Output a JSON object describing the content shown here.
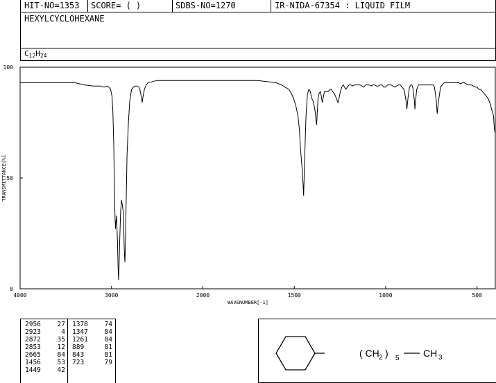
{
  "header": {
    "hit_no": "HIT-NO=1353",
    "score": "SCORE=  (  )",
    "sdbs_no": "SDBS-NO=1270",
    "ir_id": "IR-NIDA-67354 : LIQUID FILM"
  },
  "compound": {
    "name": "HEXYLCYCLOHEXANE",
    "formula_parts": [
      {
        "text": "C",
        "sub": false
      },
      {
        "text": "12",
        "sub": true
      },
      {
        "text": "H",
        "sub": false
      },
      {
        "text": "24",
        "sub": true
      }
    ]
  },
  "structure": {
    "chain_open": "( CH",
    "chain_sub": "2",
    "chain_close": ")",
    "chain_repeat": "5",
    "terminal": "CH",
    "terminal_sub": "3"
  },
  "peak_table": {
    "left": [
      [
        "2956",
        "27"
      ],
      [
        "2923",
        "4"
      ],
      [
        "2872",
        "35"
      ],
      [
        "2853",
        "12"
      ],
      [
        "2665",
        "84"
      ],
      [
        "1456",
        "53"
      ],
      [
        "1449",
        "42"
      ]
    ],
    "right": [
      [
        "1378",
        "74"
      ],
      [
        "1347",
        "84"
      ],
      [
        "1261",
        "84"
      ],
      [
        "889",
        "81"
      ],
      [
        "843",
        "81"
      ],
      [
        "723",
        "79"
      ]
    ]
  },
  "chart_data": {
    "type": "line",
    "title": "",
    "xlabel": "WAVENUMBER[-1]",
    "ylabel": "TRANSMITTANCE[%]",
    "xlim": [
      4000,
      400
    ],
    "ylim": [
      0,
      100
    ],
    "x_ticks": [
      4000,
      3000,
      2000,
      1500,
      1000,
      500
    ],
    "y_ticks": [
      0,
      50,
      100
    ],
    "x_tick_labels": [
      "4000",
      "3000",
      "2000",
      "1500",
      "1000",
      "500"
    ],
    "y_tick_labels": [
      "0",
      "50",
      "100"
    ],
    "series": [
      {
        "x": [
          4000,
          3800,
          3600,
          3400,
          3300,
          3200,
          3150,
          3120,
          3080,
          3050,
          3030,
          3010,
          2995,
          2985,
          2975,
          2968,
          2962,
          2958,
          2956,
          2952,
          2945,
          2935,
          2928,
          2923,
          2918,
          2910,
          2900,
          2890,
          2882,
          2876,
          2872,
          2868,
          2862,
          2858,
          2853,
          2848,
          2840,
          2830,
          2815,
          2800,
          2780,
          2760,
          2740,
          2720,
          2700,
          2690,
          2680,
          2672,
          2665,
          2658,
          2650,
          2640,
          2620,
          2600,
          2550,
          2500,
          2450,
          2400,
          2350,
          2300,
          2200,
          2100,
          2000,
          1900,
          1800,
          1700,
          1650,
          1600,
          1570,
          1550,
          1530,
          1515,
          1500,
          1490,
          1480,
          1472,
          1466,
          1460,
          1456,
          1452,
          1449,
          1446,
          1442,
          1436,
          1428,
          1420,
          1412,
          1405,
          1398,
          1392,
          1386,
          1382,
          1378,
          1374,
          1370,
          1365,
          1358,
          1352,
          1347,
          1342,
          1335,
          1325,
          1315,
          1305,
          1298,
          1290,
          1280,
          1270,
          1261,
          1255,
          1248,
          1240,
          1232,
          1225,
          1218,
          1210,
          1200,
          1190,
          1180,
          1170,
          1160,
          1150,
          1140,
          1130,
          1120,
          1110,
          1100,
          1090,
          1080,
          1070,
          1060,
          1050,
          1040,
          1030,
          1020,
          1010,
          1000,
          990,
          980,
          970,
          960,
          950,
          940,
          930,
          920,
          910,
          900,
          895,
          889,
          884,
          878,
          870,
          862,
          856,
          850,
          846,
          843,
          840,
          836,
          830,
          820,
          810,
          800,
          790,
          780,
          770,
          760,
          750,
          740,
          733,
          728,
          723,
          718,
          712,
          705,
          700,
          690,
          680,
          670,
          660,
          650,
          640,
          630,
          620,
          610,
          600,
          590,
          580,
          570,
          560,
          550,
          540,
          530,
          520,
          510,
          500,
          490,
          480,
          470,
          460,
          450,
          440,
          430,
          420,
          410,
          405,
          400
        ],
        "y": [
          93,
          93,
          93,
          93,
          92,
          91.5,
          91.5,
          91.5,
          91,
          91.5,
          91,
          90,
          87,
          80,
          65,
          45,
          32,
          29,
          27,
          30,
          33,
          22,
          10,
          4,
          10,
          22,
          35,
          40,
          38,
          36,
          35,
          32,
          20,
          15,
          12,
          20,
          38,
          60,
          75,
          85,
          90,
          91,
          91.5,
          91.5,
          91,
          90,
          88,
          86,
          84,
          86,
          88,
          90,
          92,
          93,
          93.5,
          94,
          94,
          94,
          94,
          94,
          94,
          94,
          94,
          94,
          94,
          94,
          93.5,
          93,
          92,
          91,
          90,
          88,
          85,
          82,
          78,
          72,
          63,
          57,
          53,
          47,
          42,
          50,
          62,
          78,
          88,
          90,
          89,
          86,
          85,
          83,
          80,
          77,
          74,
          80,
          86,
          88,
          89,
          87,
          84,
          86,
          89,
          89,
          89,
          90,
          90,
          89,
          88,
          86,
          84,
          86,
          89,
          91,
          92,
          91,
          90,
          91,
          92,
          92,
          91.5,
          92,
          92,
          92,
          92,
          91.5,
          91,
          92,
          92,
          92,
          91.5,
          92,
          92,
          91.5,
          91.5,
          92,
          92,
          91,
          91,
          92,
          92,
          92,
          91.5,
          91,
          91.5,
          92,
          92,
          91,
          90,
          88,
          85,
          81,
          86,
          91,
          92,
          92,
          90,
          87,
          85,
          81,
          85,
          90,
          92,
          92,
          92,
          92,
          92,
          92,
          92,
          92,
          92,
          91,
          88,
          85,
          79,
          84,
          88,
          91,
          92,
          93,
          93,
          93,
          93,
          93,
          93,
          93,
          93,
          93,
          92.5,
          93,
          93,
          92.5,
          92,
          92,
          92,
          91.5,
          91,
          91,
          90,
          90,
          89,
          88,
          87,
          86,
          84,
          81,
          78,
          72,
          70
        ]
      }
    ]
  }
}
